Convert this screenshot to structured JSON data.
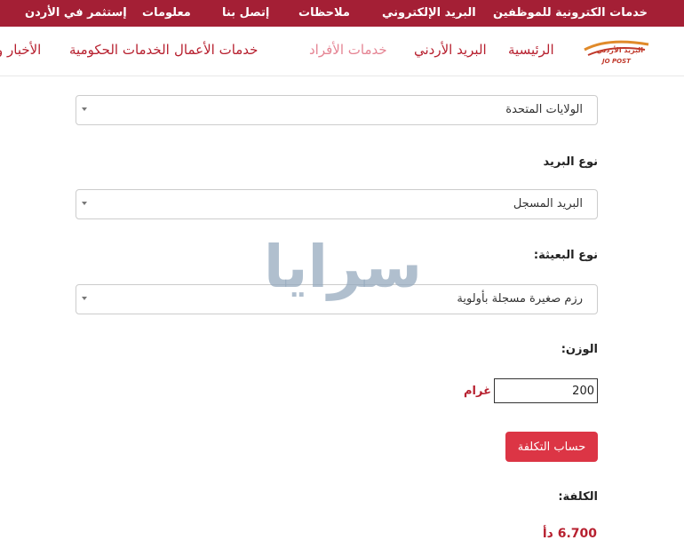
{
  "topbar": {
    "links": [
      "خدمات الكترونية للموظفين",
      "البريد الإلكتروني",
      "ملاحظات",
      "إتصل بنا",
      "معلومات",
      "إستثمر في الأردن"
    ]
  },
  "logo": {
    "arabic": "البريد الأردني",
    "english": "JO POST"
  },
  "navbar": {
    "links": [
      "الرئيسية",
      "البريد الأردني",
      "خدمات الأفراد",
      "خدمات الأعمال",
      "الخدمات الحكومية",
      "الأخبار و"
    ],
    "active": "خدمات الأفراد"
  },
  "form": {
    "country_value": "الولايات المتحدة",
    "mail_type_label": "نوع البريد",
    "mail_type_value": "البريد المسجل",
    "package_type_label": "نوع البعيثة:",
    "package_type_value": "رزم صغيرة مسجلة بأولوية",
    "weight_label": "الوزن:",
    "weight_value": "200",
    "weight_unit": "غرام",
    "calculate_button": "حساب التكلفة",
    "cost_label": "الكلفة:",
    "cost_value": "6.700 دأ"
  },
  "watermark": {
    "text": "سرايا"
  },
  "colors": {
    "brand": "#a41f35",
    "accent": "#b7202f",
    "button": "#dc3545",
    "nav_active": "#e58493"
  }
}
